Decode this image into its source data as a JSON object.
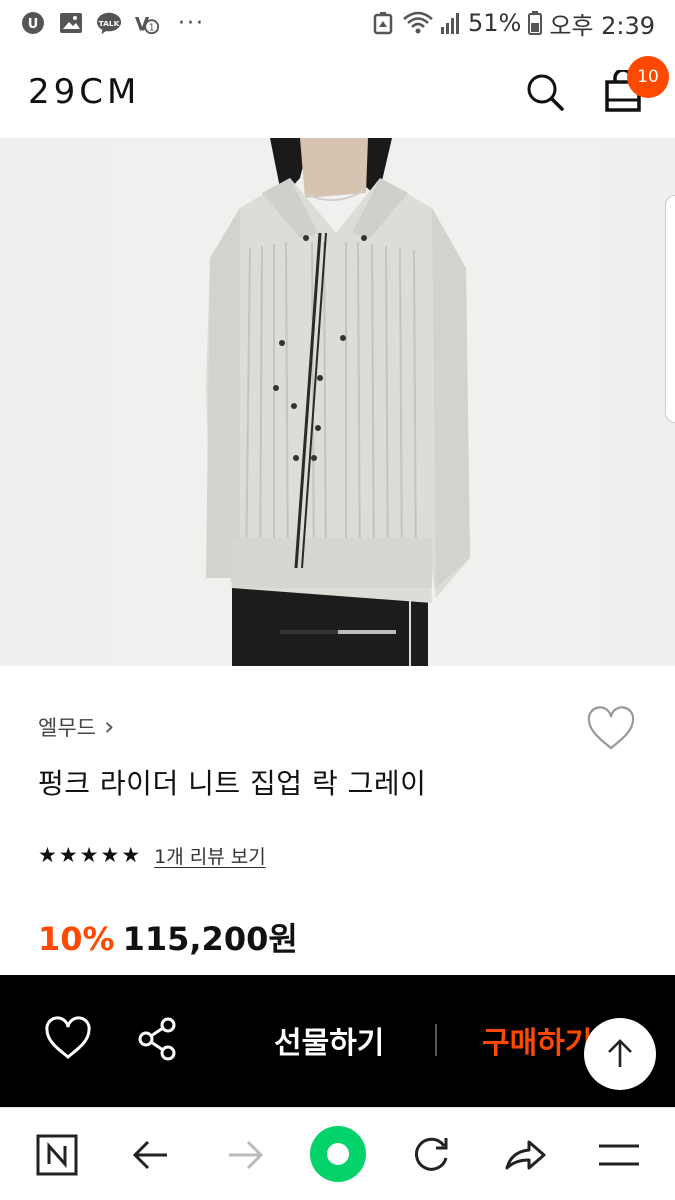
{
  "status_bar": {
    "battery_percent": "51%",
    "time": "오후 2:39",
    "talk_label": "TALK",
    "overflow": "···"
  },
  "header": {
    "logo": "29CM",
    "cart_count": "10"
  },
  "gallery": {
    "current_slide": 1,
    "total_slides": 2
  },
  "product": {
    "brand": "엘무드",
    "brand_chevron": "›",
    "title": "펑크 라이더 니트 집업 락 그레이",
    "rating_stars": 5,
    "review_link": "1개 리뷰 보기",
    "discount": "10%",
    "price": "115,200원"
  },
  "buy_bar": {
    "gift_label": "선물하기",
    "buy_label": "구매하기"
  },
  "icons": {
    "like": "heart-icon",
    "share": "share-icon",
    "scroll_top": "arrow-up-icon",
    "search": "search-icon",
    "cart": "shopping-bag-icon"
  },
  "colors": {
    "accent": "#ff4800",
    "buy_bar_bg": "#000000",
    "browser_green": "#03d36a"
  }
}
